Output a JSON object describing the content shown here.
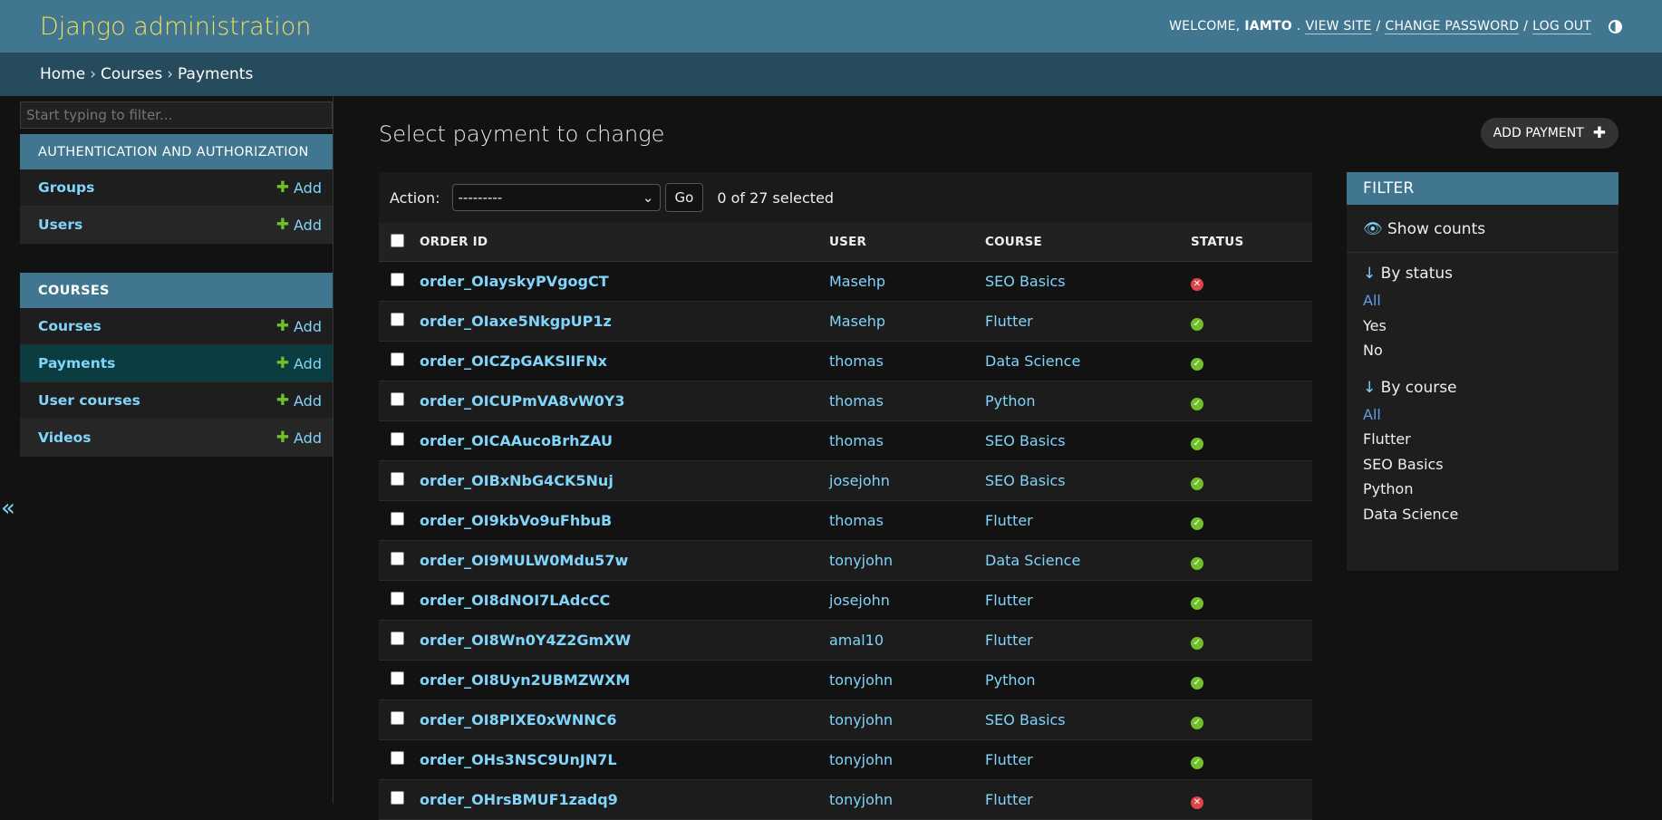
{
  "header": {
    "branding": "Django administration",
    "welcome": "WELCOME,",
    "username": "IAMTO",
    "view_site": "VIEW SITE",
    "change_password": "CHANGE PASSWORD",
    "log_out": "LOG OUT",
    "separator": "/",
    "theme_toggle_icon": "half-circle-icon"
  },
  "breadcrumbs": {
    "items": [
      "Home",
      "Courses",
      "Payments"
    ],
    "separator": "›"
  },
  "sidebar": {
    "filter_placeholder": "Start typing to filter...",
    "toggle_glyph": "«",
    "add_label": "Add",
    "modules": [
      {
        "caption": "AUTHENTICATION AND AUTHORIZATION",
        "models": [
          "Groups",
          "Users"
        ]
      },
      {
        "caption": "COURSES",
        "models": [
          "Courses",
          "Payments",
          "User courses",
          "Videos"
        ],
        "current": "Payments"
      }
    ]
  },
  "content": {
    "title": "Select payment to change",
    "add_button": "ADD PAYMENT",
    "action_label": "Action:",
    "action_selected": "---------",
    "go_label": "Go",
    "selected_count": "0 of 27 selected",
    "columns": [
      "ORDER ID",
      "USER",
      "COURSE",
      "STATUS"
    ],
    "rows": [
      {
        "order": "order_OIayskyPVgogCT",
        "user": "Masehp",
        "course": "SEO Basics",
        "status": false
      },
      {
        "order": "order_OIaxe5NkgpUP1z",
        "user": "Masehp",
        "course": "Flutter",
        "status": true
      },
      {
        "order": "order_OICZpGAKSlIFNx",
        "user": "thomas",
        "course": "Data Science",
        "status": true
      },
      {
        "order": "order_OICUPmVA8vW0Y3",
        "user": "thomas",
        "course": "Python",
        "status": true
      },
      {
        "order": "order_OICAAucoBrhZAU",
        "user": "thomas",
        "course": "SEO Basics",
        "status": true
      },
      {
        "order": "order_OIBxNbG4CK5Nuj",
        "user": "josejohn",
        "course": "SEO Basics",
        "status": true
      },
      {
        "order": "order_OI9kbVo9uFhbuB",
        "user": "thomas",
        "course": "Flutter",
        "status": true
      },
      {
        "order": "order_OI9MULW0Mdu57w",
        "user": "tonyjohn",
        "course": "Data Science",
        "status": true
      },
      {
        "order": "order_OI8dNOI7LAdcCC",
        "user": "josejohn",
        "course": "Flutter",
        "status": true
      },
      {
        "order": "order_OI8Wn0Y4Z2GmXW",
        "user": "amal10",
        "course": "Flutter",
        "status": true
      },
      {
        "order": "order_OI8Uyn2UBMZWXM",
        "user": "tonyjohn",
        "course": "Python",
        "status": true
      },
      {
        "order": "order_OI8PIXE0xWNNC6",
        "user": "tonyjohn",
        "course": "SEO Basics",
        "status": true
      },
      {
        "order": "order_OHs3NSC9UnJN7L",
        "user": "tonyjohn",
        "course": "Flutter",
        "status": true
      },
      {
        "order": "order_OHrsBMUF1zadq9",
        "user": "tonyjohn",
        "course": "Flutter",
        "status": false
      }
    ]
  },
  "filter": {
    "title": "FILTER",
    "show_counts": "Show counts",
    "groups": [
      {
        "heading": "By status",
        "options": [
          "All",
          "Yes",
          "No"
        ],
        "selected": "All"
      },
      {
        "heading": "By course",
        "options": [
          "All",
          "Flutter",
          "SEO Basics",
          "Python",
          "Data Science"
        ],
        "selected": "All"
      }
    ]
  },
  "colors": {
    "header_bg": "#417690",
    "breadcrumbs_bg": "#264b5d",
    "branding": "#f5dd5d",
    "link": "#81d4fa",
    "yes_icon": "#70bf2b",
    "no_icon": "#dd4646"
  }
}
